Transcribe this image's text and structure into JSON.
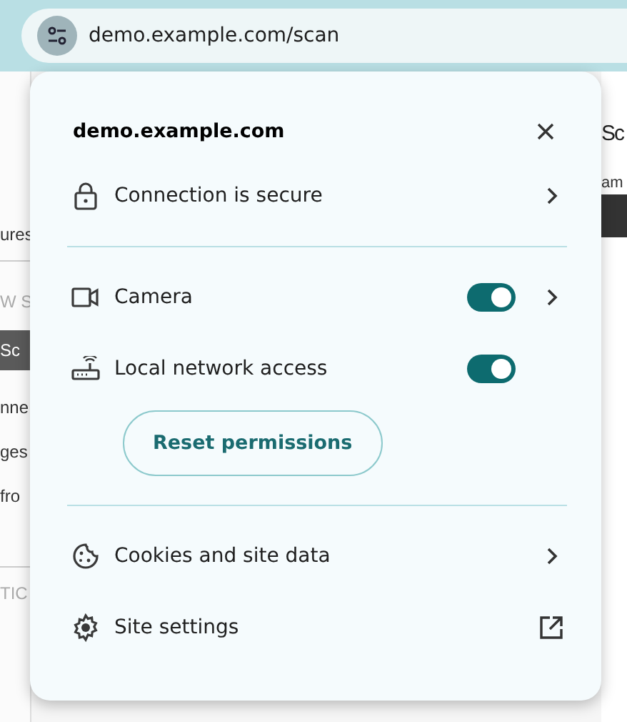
{
  "address_bar": {
    "url": "demo.example.com/scan"
  },
  "background_page": {
    "left_fragments": [
      {
        "text": "ures",
        "kind": "plain"
      },
      {
        "text": "W S",
        "kind": "faded"
      },
      {
        "text": "Sc",
        "kind": "highlighted"
      },
      {
        "text": "nne",
        "kind": "plain"
      },
      {
        "text": "ges",
        "kind": "plain"
      },
      {
        "text": "fro",
        "kind": "plain"
      },
      {
        "text": "TIC",
        "kind": "faded"
      }
    ],
    "right_fragments": [
      {
        "text": "Sc",
        "kind": "heading"
      },
      {
        "text": "am",
        "kind": "plain"
      }
    ]
  },
  "popup": {
    "title": "demo.example.com",
    "sections": [
      {
        "rows": [
          {
            "kind": "link",
            "label": "Connection is secure"
          }
        ]
      },
      {
        "rows": [
          {
            "kind": "toggle",
            "label": "Camera",
            "on": true,
            "has_details": true
          },
          {
            "kind": "toggle",
            "label": "Local network access",
            "on": true,
            "has_details": false
          }
        ],
        "button": "Reset permissions"
      },
      {
        "rows": [
          {
            "kind": "link",
            "label": "Cookies and site data"
          },
          {
            "kind": "external",
            "label": "Site settings"
          }
        ]
      }
    ]
  }
}
